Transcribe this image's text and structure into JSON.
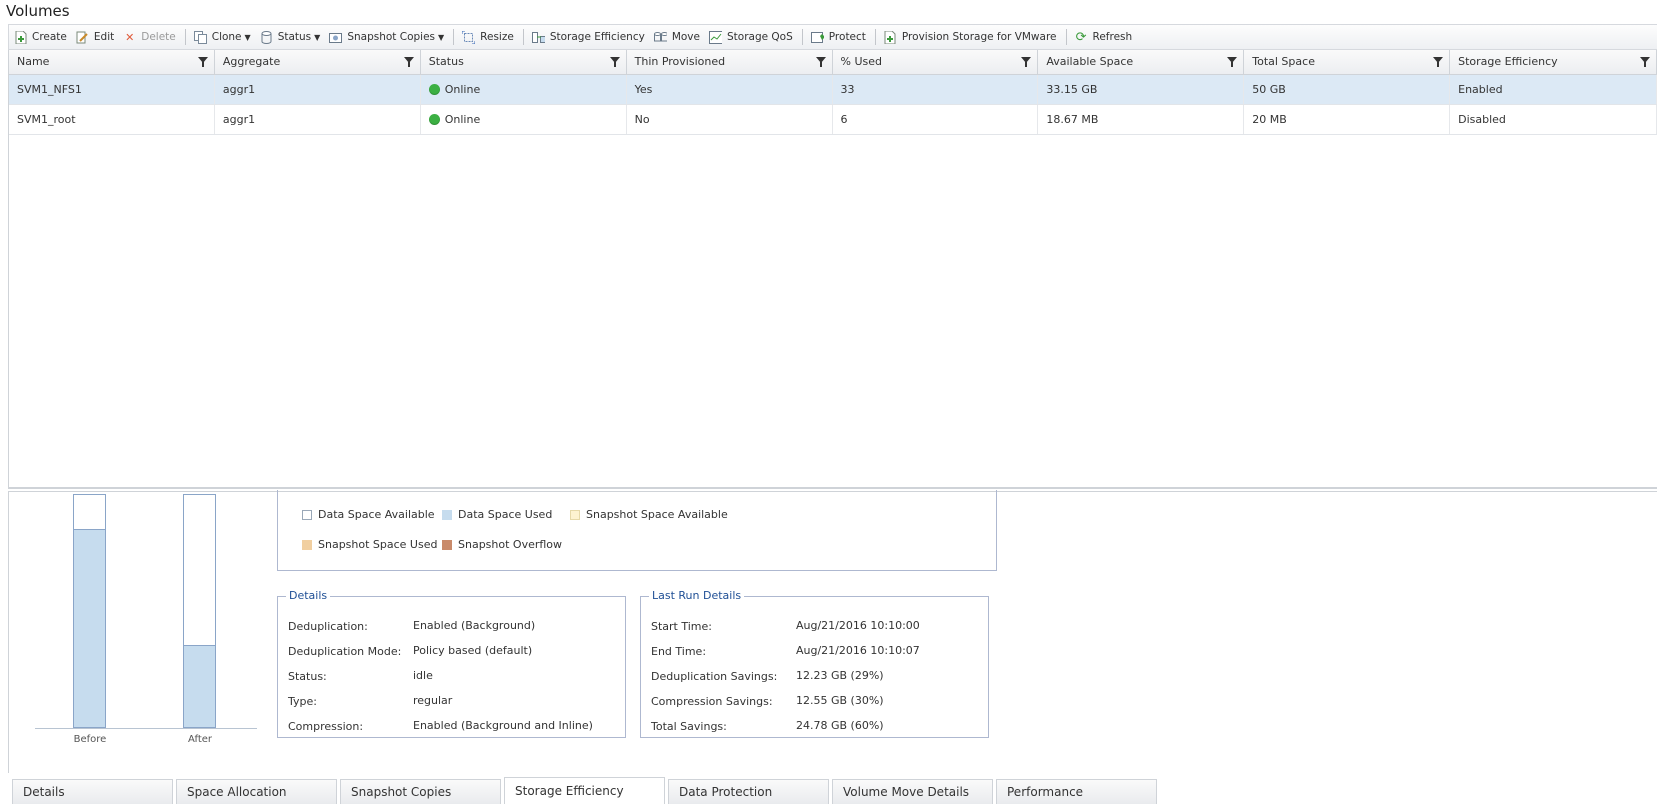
{
  "page": {
    "title": "Volumes"
  },
  "toolbar": {
    "create": "Create",
    "edit": "Edit",
    "delete": "Delete",
    "clone": "Clone",
    "status": "Status",
    "snapshot_copies": "Snapshot Copies",
    "resize": "Resize",
    "storage_efficiency": "Storage Efficiency",
    "move": "Move",
    "storage_qos": "Storage QoS",
    "protect": "Protect",
    "provision_vmware": "Provision Storage for VMware",
    "refresh": "Refresh"
  },
  "table": {
    "headers": [
      "Name",
      "Aggregate",
      "Status",
      "Thin Provisioned",
      "% Used",
      "Available Space",
      "Total Space",
      "Storage Efficiency"
    ],
    "rows": [
      [
        "SVM1_NFS1",
        "aggr1",
        "Online",
        "Yes",
        "33",
        "33.15 GB",
        "50 GB",
        "Enabled"
      ],
      [
        "SVM1_root",
        "aggr1",
        "Online",
        "No",
        "6",
        "18.67 MB",
        "20 MB",
        "Disabled"
      ]
    ]
  },
  "space_chart": {
    "before_label": "Before",
    "after_label": "After",
    "before_used_fraction": 0.85,
    "after_used_fraction": 0.35,
    "colors": {
      "used": "#c6dcee",
      "available": "#ffffff"
    }
  },
  "legend": {
    "data_space_available": "Data Space Available",
    "data_space_used": "Data Space Used",
    "snapshot_space_available": "Snapshot Space Available",
    "snapshot_space_used": "Snapshot Space Used",
    "snapshot_overflow": "Snapshot Overflow",
    "colors": {
      "dsa": "#ffffff",
      "dsu": "#c6dcee",
      "ssa": "#fdf3d0",
      "ssu": "#f1cfa0",
      "so": "#c98a6a"
    }
  },
  "details": {
    "title": "Details",
    "items": [
      {
        "label": "Deduplication:",
        "value": "Enabled (Background)"
      },
      {
        "label": "Deduplication Mode:",
        "value": "Policy based (default)"
      },
      {
        "label": "Status:",
        "value": "idle"
      },
      {
        "label": "Type:",
        "value": "regular"
      },
      {
        "label": "Compression:",
        "value": "Enabled (Background and Inline)"
      }
    ]
  },
  "last_run": {
    "title": "Last Run Details",
    "items": [
      {
        "label": "Start Time:",
        "value": "Aug/21/2016 10:10:00"
      },
      {
        "label": "End Time:",
        "value": "Aug/21/2016 10:10:07"
      },
      {
        "label": "Deduplication Savings:",
        "value": "12.23 GB (29%)"
      },
      {
        "label": "Compression Savings:",
        "value": "12.55 GB (30%)"
      },
      {
        "label": "Total Savings:",
        "value": "24.78 GB (60%)"
      }
    ]
  },
  "tabs": [
    "Details",
    "Space Allocation",
    "Snapshot Copies",
    "Storage Efficiency",
    "Data Protection",
    "Volume Move Details",
    "Performance"
  ]
}
